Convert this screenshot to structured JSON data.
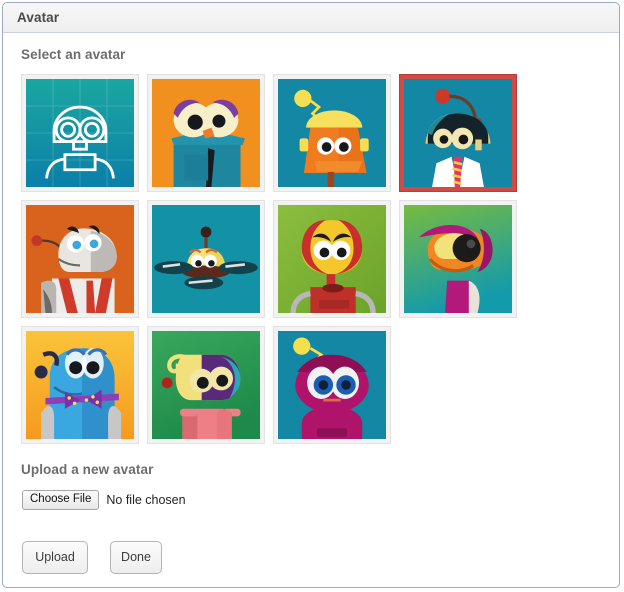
{
  "window": {
    "title": "Avatar"
  },
  "select_section": {
    "heading": "Select an avatar",
    "avatars": [
      {
        "id": "avatar-1",
        "name": "teal-blueprint-robot",
        "selected": false,
        "alt": "Outline robot on teal grid"
      },
      {
        "id": "avatar-2",
        "name": "orange-eyebrow-robot",
        "selected": false,
        "alt": "Teal robot with purple eyebrows and necktie on orange"
      },
      {
        "id": "avatar-3",
        "name": "orange-lamp-head-robot",
        "selected": false,
        "alt": "Orange robot with yellow dome and antenna on teal"
      },
      {
        "id": "avatar-4",
        "name": "lab-coat-visor-robot",
        "selected": true,
        "alt": "Robot with dark visor and lab coat with striped tie on teal"
      },
      {
        "id": "avatar-5",
        "name": "white-striped-rhino-robot",
        "selected": false,
        "alt": "White robot with black eyebrows and red stripes on orange"
      },
      {
        "id": "avatar-6",
        "name": "yellow-drone-robot",
        "selected": false,
        "alt": "Yellow hovering drone robot with rotors on teal"
      },
      {
        "id": "avatar-7",
        "name": "red-helmet-robot",
        "selected": false,
        "alt": "Yellow face in red helmet with red box body on green"
      },
      {
        "id": "avatar-8",
        "name": "magenta-visor-cyclops-robot",
        "selected": false,
        "alt": "Orange one-eyed robot with magenta visor on green teal"
      },
      {
        "id": "avatar-9",
        "name": "blue-bowtie-robot",
        "selected": false,
        "alt": "Blue robot with purple polka dot bow tie on yellow"
      },
      {
        "id": "avatar-10",
        "name": "purple-helmet-pink-robot",
        "selected": false,
        "alt": "Purple and yellow helmet robot with pink body on green"
      },
      {
        "id": "avatar-11",
        "name": "magenta-antenna-robot",
        "selected": false,
        "alt": "Magenta robot with yellow antenna ball on teal"
      }
    ]
  },
  "upload_section": {
    "heading": "Upload a new avatar",
    "file_input": {
      "button_label": "Choose File",
      "status_text": "No file chosen"
    }
  },
  "actions": {
    "upload_label": "Upload",
    "done_label": "Done"
  },
  "colors": {
    "selection_border": "#cf4b45",
    "panel_border": "#9aabc0",
    "header_background": "#f2f2f2",
    "heading_text": "#6d6d6d",
    "tile_background": "#f2f2f2"
  }
}
